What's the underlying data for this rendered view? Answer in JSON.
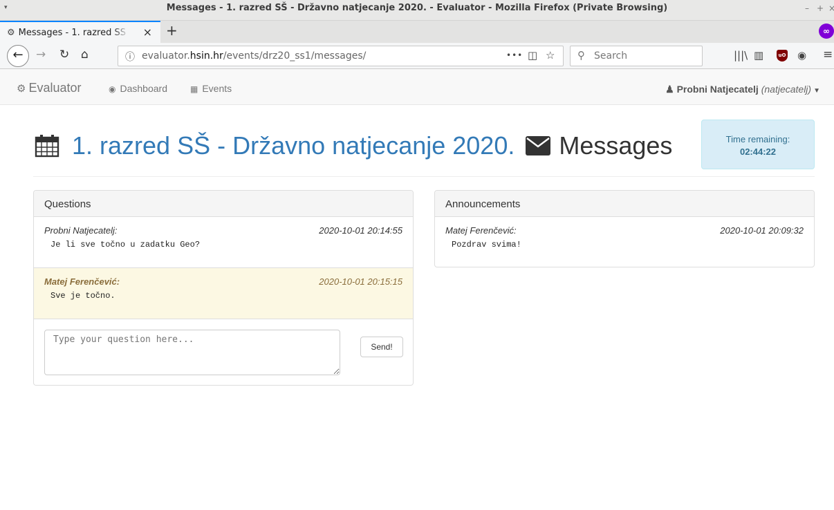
{
  "window": {
    "title": "Messages - 1. razred SŠ - Državno natjecanje 2020. - Evaluator - Mozilla Firefox (Private Browsing)",
    "controls": [
      "–",
      "+",
      "×"
    ]
  },
  "tab": {
    "title": "Messages - 1. razred SŠ",
    "close": "×",
    "new_tab": "+"
  },
  "toolbar": {
    "url_prefix": "evaluator.",
    "url_domain": "hsin.hr",
    "url_path": "/events/drz20_ss1/messages/",
    "search_placeholder": "Search",
    "page_actions": "•••"
  },
  "appnav": {
    "brand": "Evaluator",
    "dashboard": "Dashboard",
    "events": "Events",
    "user_name": "Probni Natjecatelj",
    "user_handle": "(natjecatelj)"
  },
  "page": {
    "event_title": "1. razred SŠ - Državno natjecanje 2020.",
    "section_title": "Messages",
    "time_label": "Time remaining:",
    "time_value": "02:44:22"
  },
  "questions": {
    "heading": "Questions",
    "items": [
      {
        "author": "Probni Natjecatelj:",
        "time": "2020-10-01 20:14:55",
        "text": "Je li sve točno u zadatku Geo?"
      },
      {
        "author": "Matej Ferenčević:",
        "time": "2020-10-01 20:15:15",
        "text": "Sve je točno."
      }
    ],
    "input_placeholder": "Type your question here...",
    "send_label": "Send!"
  },
  "announcements": {
    "heading": "Announcements",
    "items": [
      {
        "author": "Matej Ferenčević:",
        "time": "2020-10-01 20:09:32",
        "text": "Pozdrav svima!"
      }
    ]
  },
  "colors": {
    "link": "#337ab7",
    "answer_bg": "#fcf8e3",
    "answer_text": "#8a6d3b",
    "time_box_bg": "#d9edf7",
    "time_box_text": "#31708f",
    "tab_accent": "#0a84ff",
    "private_badge": "#8000d7"
  }
}
